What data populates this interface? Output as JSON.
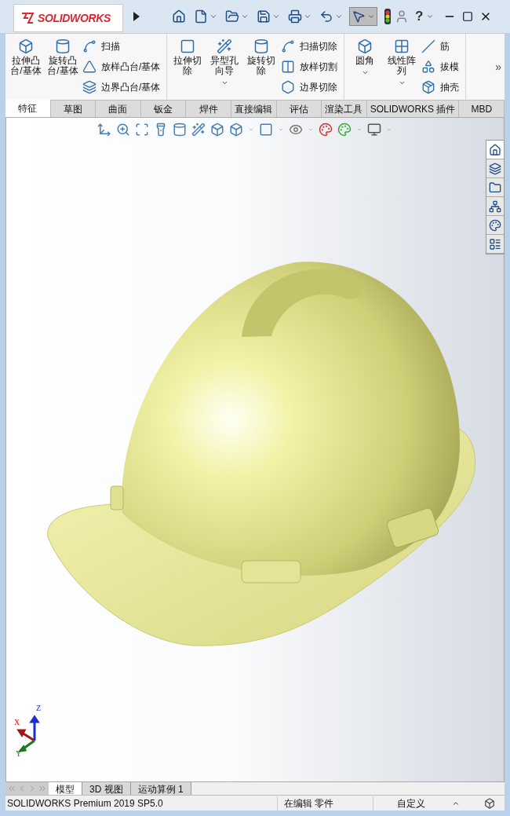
{
  "title_bar": {
    "logo_text": "SOLIDWORKS",
    "help": "?",
    "tools": [
      {
        "kind": "home",
        "dropdown": false,
        "selected": false
      },
      {
        "kind": "new",
        "dropdown": true,
        "selected": false
      },
      {
        "kind": "open",
        "dropdown": true,
        "selected": false
      },
      {
        "kind": "save",
        "dropdown": true,
        "selected": false
      },
      {
        "kind": "print",
        "dropdown": true,
        "selected": false
      },
      {
        "kind": "undo",
        "dropdown": true,
        "selected": false
      },
      {
        "kind": "select",
        "dropdown": true,
        "selected": true
      }
    ]
  },
  "ribbon": {
    "groups": [
      {
        "items": [
          {
            "kind": "large",
            "label": "拉伸凸台/基体",
            "dropdown": false
          },
          {
            "kind": "large",
            "label": "旋转凸台/基体",
            "dropdown": false
          },
          {
            "kind": "stack",
            "items": [
              {
                "label": "扫描"
              },
              {
                "label": "放样凸台/基体"
              },
              {
                "label": "边界凸台/基体"
              }
            ]
          }
        ]
      },
      {
        "items": [
          {
            "kind": "large",
            "label": "拉伸切除",
            "dropdown": false
          },
          {
            "kind": "large",
            "label": "异型孔向导",
            "dropdown": true
          },
          {
            "kind": "large",
            "label": "旋转切除",
            "dropdown": false
          },
          {
            "kind": "stack",
            "items": [
              {
                "label": "扫描切除"
              },
              {
                "label": "放样切割"
              },
              {
                "label": "边界切除"
              }
            ]
          }
        ]
      },
      {
        "items": [
          {
            "kind": "large",
            "label": "圆角",
            "dropdown": true
          },
          {
            "kind": "large",
            "label": "线性阵列",
            "dropdown": true
          },
          {
            "kind": "stack",
            "items": [
              {
                "label": "筋"
              },
              {
                "label": "拔模"
              },
              {
                "label": "抽壳"
              }
            ]
          }
        ]
      }
    ],
    "more": "»"
  },
  "tabs": [
    {
      "label": "特征",
      "selected": true
    },
    {
      "label": "草图",
      "selected": false
    },
    {
      "label": "曲面",
      "selected": false
    },
    {
      "label": "钣金",
      "selected": false
    },
    {
      "label": "焊件",
      "selected": false
    },
    {
      "label": "直接编辑",
      "selected": false
    },
    {
      "label": "评估",
      "selected": false
    },
    {
      "label": "渲染工具",
      "selected": false
    },
    {
      "label": "SOLIDWORKS 插件",
      "selected": false
    },
    {
      "label": "MBD",
      "selected": false
    }
  ],
  "task_pane": [
    {
      "selected": true
    },
    {
      "selected": false
    },
    {
      "selected": false
    },
    {
      "selected": false
    },
    {
      "selected": false
    },
    {
      "selected": false
    }
  ],
  "triad": {
    "x": "X",
    "y": "Y",
    "z": "Z"
  },
  "model_tabs": [
    {
      "label": "模型",
      "selected": true
    },
    {
      "label": "3D 视图",
      "selected": false
    },
    {
      "label": "运动算例 1",
      "selected": false
    }
  ],
  "status_bar": {
    "product": "SOLIDWORKS Premium 2019 SP5.0",
    "mode": "在编辑 零件",
    "units": "自定义"
  }
}
